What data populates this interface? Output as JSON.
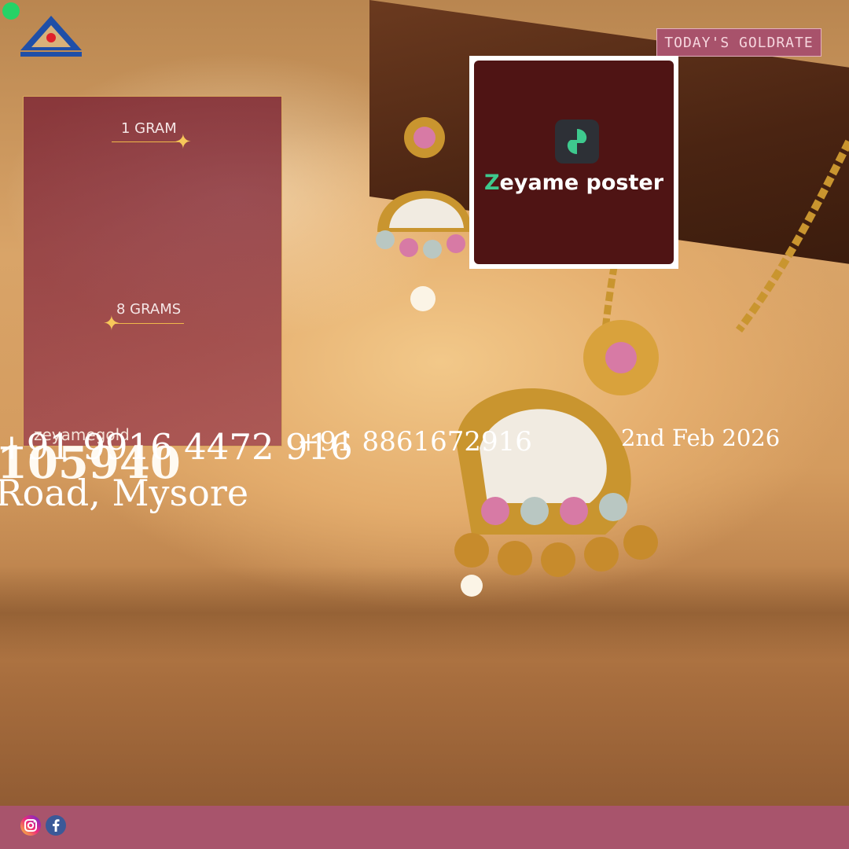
{
  "header": {
    "rate_button": "TODAY'S GOLDRATE"
  },
  "poster": {
    "brand_first": "Z",
    "brand_rest": "eyame poster"
  },
  "price_card": {
    "label_1": "1 GRAM",
    "label_2": "8 GRAMS"
  },
  "contact": {
    "brand": "zeyamegold",
    "phone_primary": "+91 9916 4472 916",
    "phone_overlap": "105940",
    "address": "Road, Mysore",
    "phone_secondary": "+91 8861672916",
    "date": "2nd Feb 2026"
  },
  "icons": [
    "instagram-icon",
    "facebook-icon",
    "whatsapp-icon"
  ],
  "colors": {
    "bar": "#a8546c",
    "accent": "#d7a75c"
  }
}
